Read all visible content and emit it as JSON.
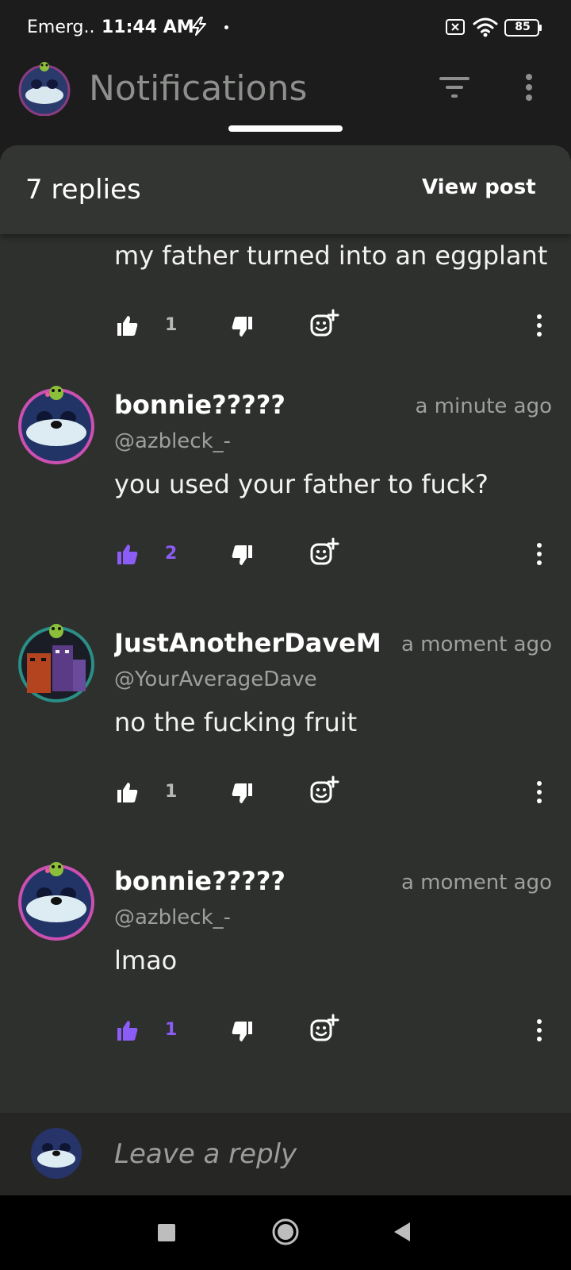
{
  "status_bar": {
    "carrier": "Emerg..",
    "time": "11:44 AM",
    "battery": "85",
    "icons": [
      "bolt-icon",
      "dot-icon",
      "sim-x-icon",
      "wifi-icon",
      "battery-icon"
    ]
  },
  "app_bar": {
    "title": "Notifications",
    "icons": [
      "filter-icon",
      "more-vert-icon"
    ]
  },
  "sheet": {
    "replies_count": "7 replies",
    "view_post_label": "View post"
  },
  "colors": {
    "accent": "#8b5cf6",
    "sheet_bg": "#2e302d",
    "header_bg": "#333532",
    "muted": "#9fa09e"
  },
  "partial_comment": {
    "text": "my father turned into an eggplant",
    "likes": "1",
    "liked": false
  },
  "comments": [
    {
      "author": "bonnie?????",
      "handle": "@azbleck_-",
      "time": "a minute ago",
      "text": "you used your father to fuck?",
      "likes": "2",
      "liked": true
    },
    {
      "author": "JustAnotherDaveMil",
      "handle": "@YourAverageDave",
      "time": "a moment ago",
      "text": "no the fucking fruit",
      "likes": "1",
      "liked": false
    },
    {
      "author": "bonnie?????",
      "handle": "@azbleck_-",
      "time": "a moment ago",
      "text": "lmao",
      "likes": "1",
      "liked": true
    }
  ],
  "reply_bar": {
    "placeholder": "Leave a reply"
  },
  "nav_bar": {
    "icons": [
      "recents-icon",
      "home-icon",
      "back-icon"
    ]
  }
}
